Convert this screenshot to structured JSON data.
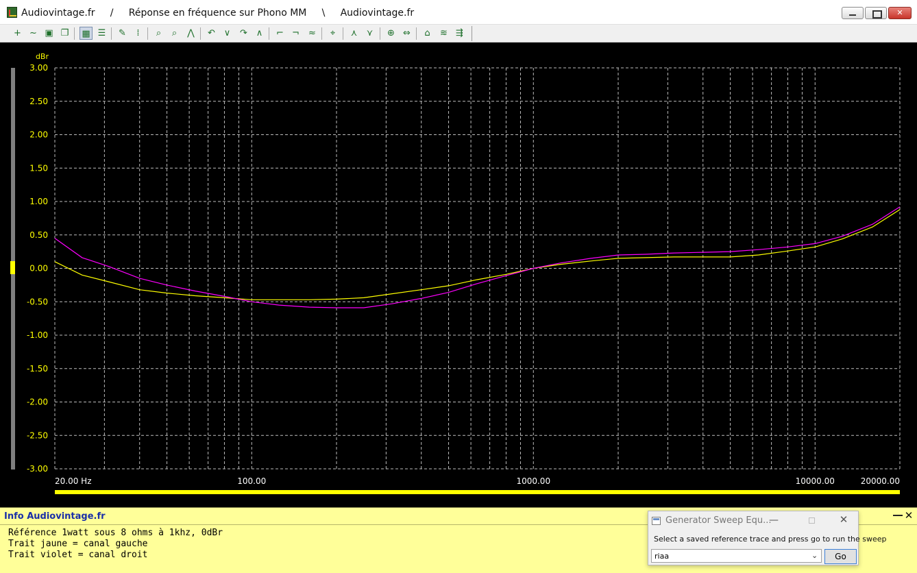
{
  "window": {
    "title": "Audiovintage.fr     /     Réponse en fréquence sur Phono MM     \\     Audiovintage.fr"
  },
  "toolbar": {
    "buttons": [
      {
        "icon": "add-trace-icon",
        "glyph": "+"
      },
      {
        "icon": "wave-trace-icon",
        "glyph": "~"
      },
      {
        "icon": "save-icon",
        "glyph": "▣"
      },
      {
        "icon": "copy-icon",
        "glyph": "❐"
      },
      {
        "icon": "graph-view-icon",
        "glyph": "▦"
      },
      {
        "icon": "table-view-icon",
        "glyph": "☰"
      },
      {
        "icon": "edit-chart-icon",
        "glyph": "✎"
      },
      {
        "icon": "grid-icon",
        "glyph": "⁞"
      },
      {
        "icon": "zoom-in-icon",
        "glyph": "⌕"
      },
      {
        "icon": "zoom-out-icon",
        "glyph": "⌕"
      },
      {
        "icon": "fit-trace-icon",
        "glyph": "⋀"
      },
      {
        "icon": "shift-left-icon",
        "glyph": "↶"
      },
      {
        "icon": "shift-down-icon",
        "glyph": "∨"
      },
      {
        "icon": "shift-right-icon",
        "glyph": "↷"
      },
      {
        "icon": "shift-up-icon",
        "glyph": "∧"
      },
      {
        "icon": "marker-left-icon",
        "glyph": "⌐"
      },
      {
        "icon": "marker-right-icon",
        "glyph": "¬"
      },
      {
        "icon": "overlay-icon",
        "glyph": "≈"
      },
      {
        "icon": "auto-scale-icon",
        "glyph": "⌖"
      },
      {
        "icon": "peak-up-icon",
        "glyph": "⋏"
      },
      {
        "icon": "peak-down-icon",
        "glyph": "⋎"
      },
      {
        "icon": "sweep-generator-icon",
        "glyph": "⊕"
      },
      {
        "icon": "level-icon",
        "glyph": "⇔"
      },
      {
        "icon": "reference-trace-icon",
        "glyph": "⌂"
      },
      {
        "icon": "compare-icon",
        "glyph": "≋"
      },
      {
        "icon": "settings-icon",
        "glyph": "⇶"
      }
    ]
  },
  "colors": {
    "background": "#000000",
    "grid": "#bdbdbd",
    "tick_label": "#ffff00",
    "x_label": "#ffffff",
    "left_channel": "#ffff00",
    "right_channel": "#ff00ff",
    "info_panel": "#ffff99",
    "info_title": "#1a2fa8"
  },
  "chart_data": {
    "type": "line",
    "xlabel": "",
    "ylabel": "dBr",
    "xscale": "log",
    "xlim": [
      20,
      20000
    ],
    "ylim": [
      -3.0,
      3.0
    ],
    "grid": true,
    "x_tick_labels": [
      {
        "value": 20,
        "label": "20.00 Hz"
      },
      {
        "value": 100,
        "label": "100.00"
      },
      {
        "value": 1000,
        "label": "1000.00"
      },
      {
        "value": 10000,
        "label": "10000.00"
      },
      {
        "value": 20000,
        "label": "20000.00"
      }
    ],
    "y_tick_labels": [
      "3.00",
      "2.50",
      "2.00",
      "1.50",
      "1.00",
      "0.50",
      "0.00",
      "-0.50",
      "-1.00",
      "-1.50",
      "-2.00",
      "-2.50",
      "-3.00"
    ],
    "series": [
      {
        "color": "#ffff00",
        "x": [
          20,
          25,
          31,
          40,
          50,
          63,
          80,
          100,
          125,
          160,
          200,
          250,
          315,
          400,
          500,
          630,
          800,
          1000,
          1250,
          1600,
          2000,
          2500,
          3150,
          4000,
          5000,
          6300,
          8000,
          10000,
          12500,
          16000,
          20000
        ],
        "y": [
          0.1,
          -0.1,
          -0.2,
          -0.32,
          -0.37,
          -0.41,
          -0.44,
          -0.47,
          -0.47,
          -0.47,
          -0.46,
          -0.44,
          -0.38,
          -0.32,
          -0.26,
          -0.17,
          -0.09,
          0.0,
          0.06,
          0.11,
          0.15,
          0.16,
          0.17,
          0.17,
          0.17,
          0.2,
          0.26,
          0.32,
          0.44,
          0.62,
          0.88
        ]
      },
      {
        "color": "#ff00ff",
        "x": [
          20,
          25,
          31,
          40,
          50,
          63,
          80,
          100,
          125,
          160,
          200,
          250,
          315,
          400,
          500,
          630,
          800,
          1000,
          1250,
          1600,
          2000,
          2500,
          3150,
          4000,
          5000,
          6300,
          8000,
          10000,
          12500,
          16000,
          20000
        ],
        "y": [
          0.45,
          0.16,
          0.03,
          -0.15,
          -0.25,
          -0.34,
          -0.42,
          -0.5,
          -0.55,
          -0.58,
          -0.59,
          -0.59,
          -0.53,
          -0.45,
          -0.36,
          -0.23,
          -0.11,
          0.0,
          0.08,
          0.15,
          0.2,
          0.21,
          0.23,
          0.24,
          0.25,
          0.28,
          0.32,
          0.37,
          0.48,
          0.66,
          0.92
        ]
      }
    ]
  },
  "info": {
    "title": "Info Audiovintage.fr",
    "lines": [
      "Référence 1watt sous 8 ohms à 1khz, 0dBr",
      "Trait jaune = canal gauche",
      "Trait violet = canal droit"
    ]
  },
  "dialog": {
    "title": "Generator Sweep Equ...",
    "message": "Select a saved reference trace and press go to run the sweep",
    "selected_trace": "riaa",
    "go_label": "Go"
  }
}
